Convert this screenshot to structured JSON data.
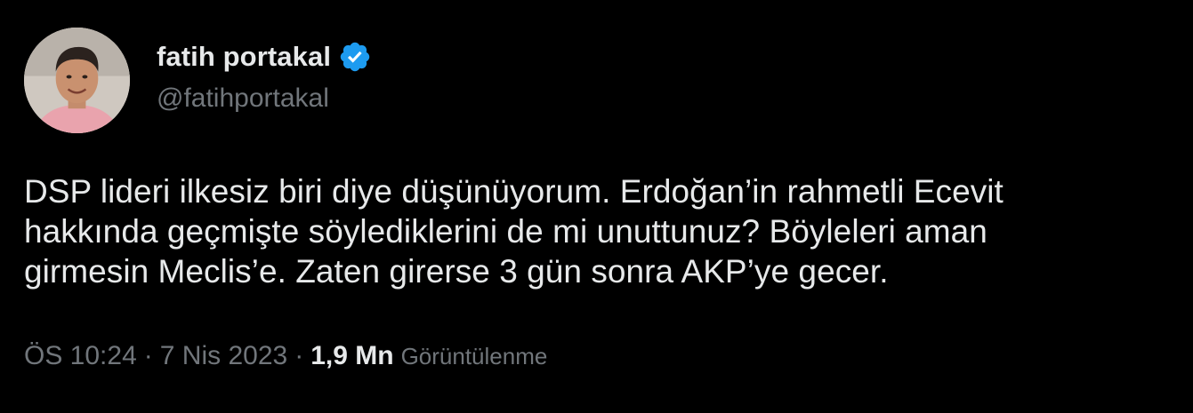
{
  "author": {
    "display_name": "fatih portakal",
    "handle": "@fatihportakal",
    "verified_icon": "verified-badge-icon",
    "verified_color": "#1d9bf0"
  },
  "tweet": {
    "text_lines": [
      "DSP lideri ilkesiz biri diye düşünüyorum. Erdoğan’in rahmetli Ecevit",
      "hakkında geçmişte söylediklerini de mi unuttunuz? Böyleleri aman",
      "girmesin Meclis’e. Zaten girerse 3 gün sonra AKP’ye gecer."
    ]
  },
  "meta": {
    "time": "ÖS 10:24",
    "separator": "·",
    "date": "7 Nis 2023",
    "views_count": "1,9 Mn",
    "views_label": "Görüntülenme"
  },
  "colors": {
    "background": "#000000",
    "primary_text": "#e7e9ea",
    "secondary_text": "#71767b"
  }
}
